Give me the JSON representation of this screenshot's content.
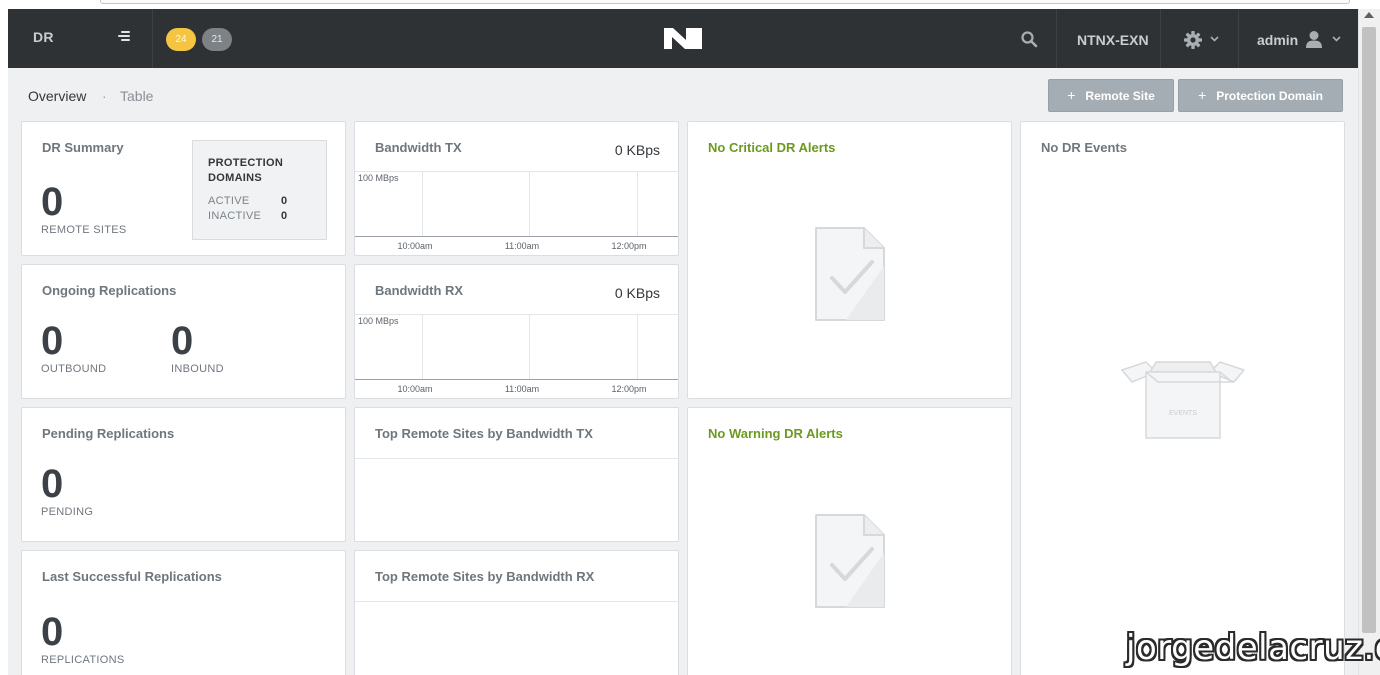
{
  "header": {
    "section_title": "DR",
    "badge_critical": "24",
    "badge_warning": "21",
    "cluster_name": "NTNX-EXN",
    "user_name": "admin"
  },
  "tabs": {
    "overview": "Overview",
    "separator": "·",
    "table": "Table"
  },
  "actions": {
    "plus": "+",
    "remote_site": "Remote Site",
    "protection_domain": "Protection Domain"
  },
  "dr_summary": {
    "title": "DR Summary",
    "remote_sites_count": "0",
    "remote_sites_label": "REMOTE SITES",
    "protection_domains_heading_line1": "PROTECTION",
    "protection_domains_heading_line2": "DOMAINS",
    "active_label": "ACTIVE",
    "active_value": "0",
    "inactive_label": "INACTIVE",
    "inactive_value": "0"
  },
  "bandwidth_tx": {
    "title": "Bandwidth TX",
    "value": "0 KBps",
    "y_label": "100 MBps",
    "x_ticks": [
      "10:00am",
      "11:00am",
      "12:00pm"
    ]
  },
  "bandwidth_rx": {
    "title": "Bandwidth RX",
    "value": "0 KBps",
    "y_label": "100 MBps",
    "x_ticks": [
      "10:00am",
      "11:00am",
      "12:00pm"
    ]
  },
  "critical_alerts": {
    "title": "No Critical DR Alerts"
  },
  "warning_alerts": {
    "title": "No Warning DR Alerts"
  },
  "dr_events": {
    "title": "No DR Events",
    "box_label": "EVENTS"
  },
  "ongoing_replications": {
    "title": "Ongoing Replications",
    "outbound_count": "0",
    "outbound_label": "OUTBOUND",
    "inbound_count": "0",
    "inbound_label": "INBOUND"
  },
  "pending_replications": {
    "title": "Pending Replications",
    "count": "0",
    "label": "PENDING"
  },
  "last_successful_replications": {
    "title": "Last Successful Replications",
    "count": "0",
    "label": "REPLICATIONS"
  },
  "top_remote_tx": {
    "title": "Top Remote Sites by Bandwidth TX"
  },
  "top_remote_rx": {
    "title": "Top Remote Sites by Bandwidth RX"
  },
  "watermark": "jorgedelacruz.es"
}
